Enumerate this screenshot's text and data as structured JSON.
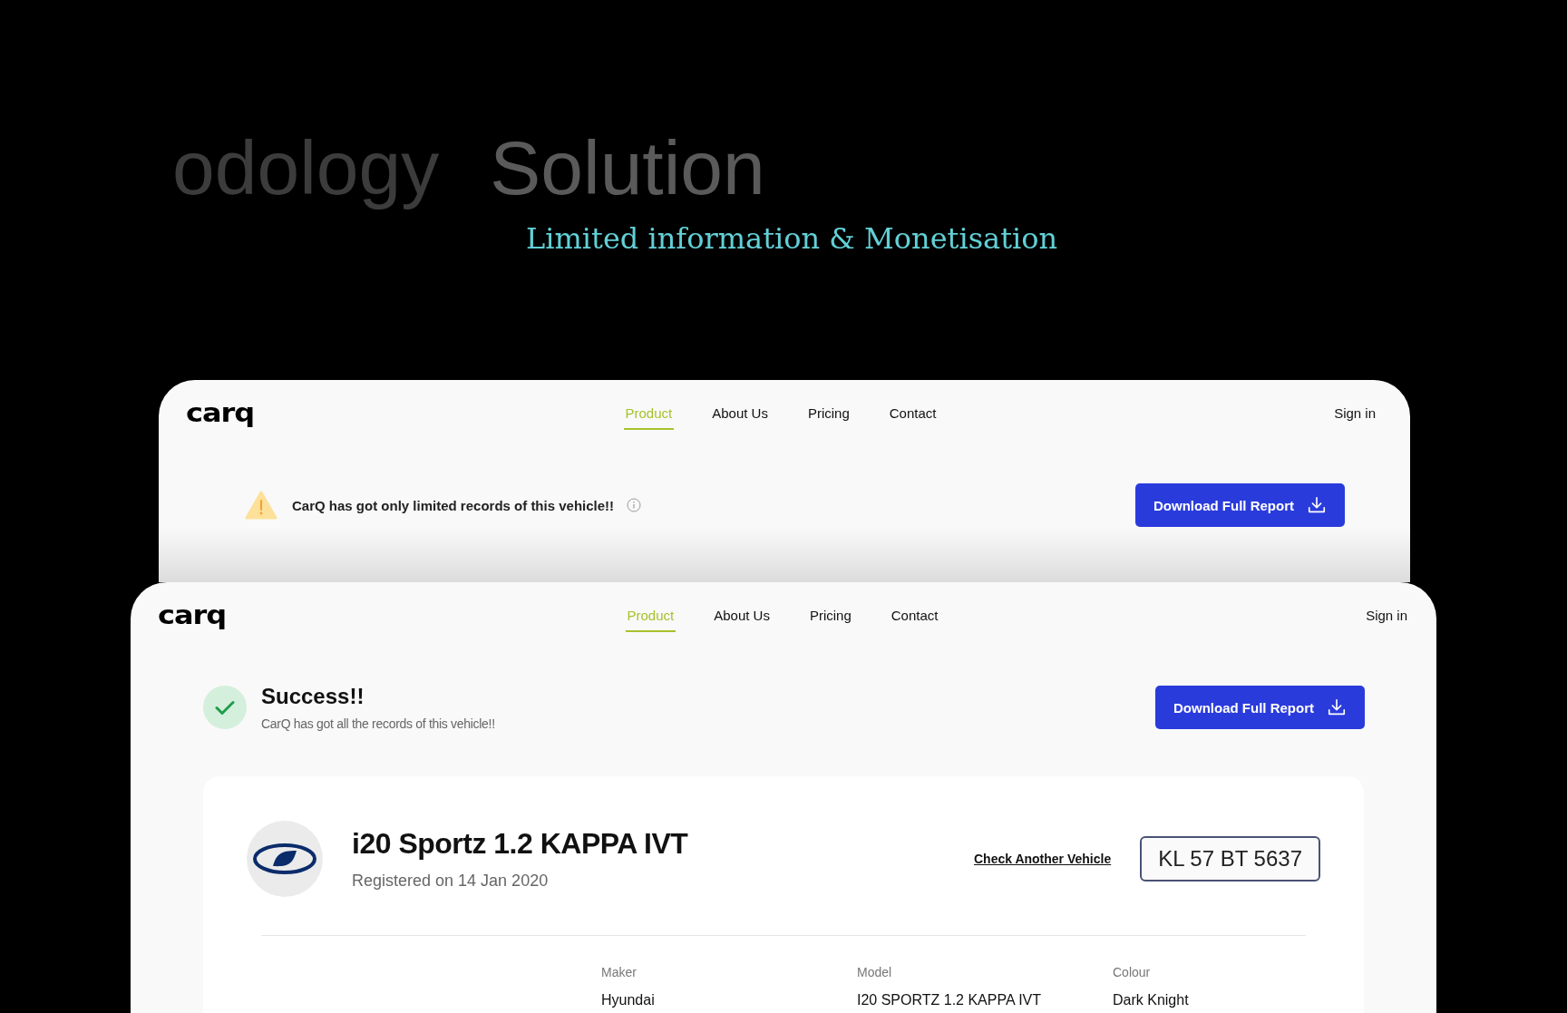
{
  "heading": {
    "previous_title": "odology",
    "title": "Solution",
    "subtitle": "Limited information & Monetisation"
  },
  "screens": [
    {
      "kind": "limited",
      "logo": "carq",
      "nav": [
        {
          "label": "Product",
          "selected": true
        },
        {
          "label": "About Us",
          "selected": false
        },
        {
          "label": "Pricing",
          "selected": false
        },
        {
          "label": "Contact",
          "selected": false
        }
      ],
      "sign_in": "Sign in",
      "alert": {
        "message": "CarQ has got only limited records of this vehicle!!"
      },
      "download_button": "Download Full Report"
    },
    {
      "kind": "success",
      "logo": "carq",
      "nav": [
        {
          "label": "Product",
          "selected": true
        },
        {
          "label": "About Us",
          "selected": false
        },
        {
          "label": "Pricing",
          "selected": false
        },
        {
          "label": "Contact",
          "selected": false
        }
      ],
      "sign_in": "Sign in",
      "status": {
        "title": "Success!!",
        "message": "CarQ has got all the records of this vehicle!!"
      },
      "download_button": "Download Full Report",
      "vehicle": {
        "name": "i20 Sportz 1.2 KAPPA IVT",
        "registered": "Registered on 14 Jan 2020",
        "check_link": "Check Another Vehicle",
        "plate": "KL 57 BT 5637",
        "details": [
          {
            "label": "Maker",
            "value": "Hyundai"
          },
          {
            "label": "Model",
            "value": "I20 SPORTZ 1.2 KAPPA IVT"
          },
          {
            "label": "Colour",
            "value": "Dark Knight"
          }
        ]
      }
    }
  ]
}
